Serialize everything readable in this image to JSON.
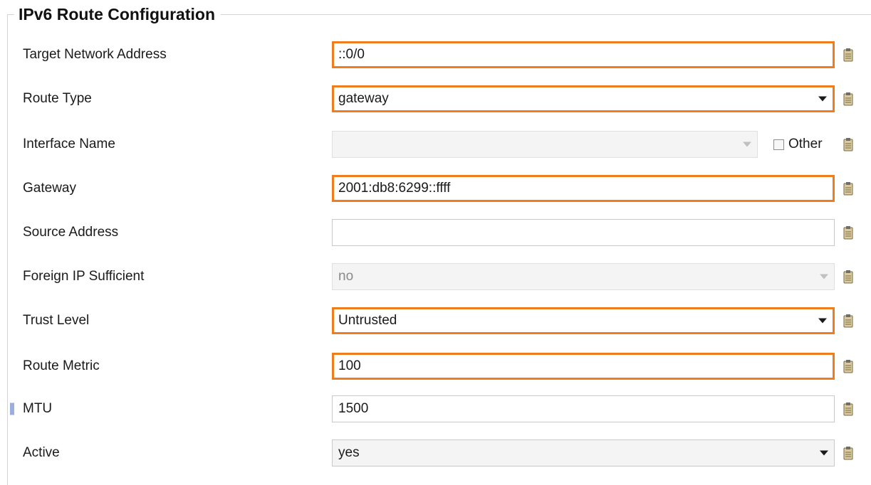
{
  "section": {
    "title": "IPv6 Route Configuration"
  },
  "fields": [
    {
      "label": "Target Network Address",
      "value": "::0/0"
    },
    {
      "label": "Route Type",
      "value": "gateway"
    },
    {
      "label": "Interface Name",
      "value": "",
      "other_label": "Other",
      "other_checked": false
    },
    {
      "label": "Gateway",
      "value": "2001:db8:6299::ffff"
    },
    {
      "label": "Source Address",
      "value": ""
    },
    {
      "label": "Foreign IP Sufficient",
      "value": "no"
    },
    {
      "label": "Trust Level",
      "value": "Untrusted"
    },
    {
      "label": "Route Metric",
      "value": "100"
    },
    {
      "label": "MTU",
      "value": "1500"
    },
    {
      "label": "Active",
      "value": "yes"
    }
  ],
  "colors": {
    "highlight_border": "#ef7d1e",
    "marker": "#9aaee0",
    "clipboard_icon": "#c8b88a"
  },
  "icons": {
    "field_action": "clipboard-icon",
    "dropdown": "chevron-down-icon"
  }
}
